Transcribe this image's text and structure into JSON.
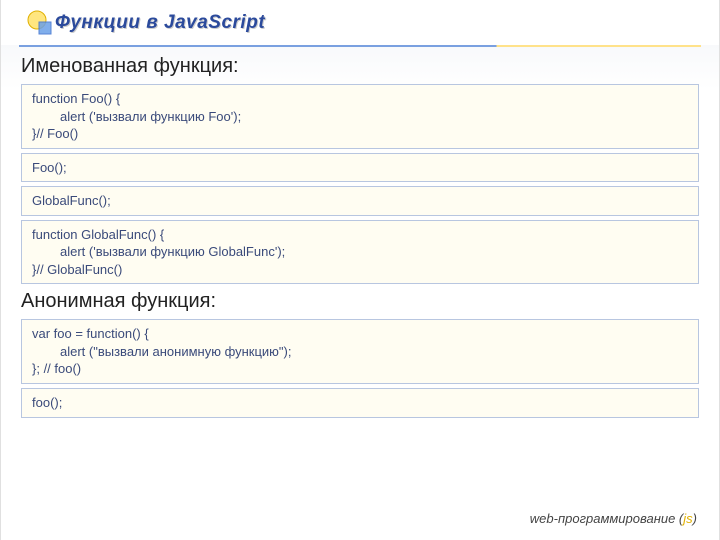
{
  "title": "Функции в JavaScript",
  "section1": "Именованная функция:",
  "box1": {
    "l1": "function Foo() {",
    "l2": "alert ('вызвали функцию Foo');",
    "l3": "}// Foo()"
  },
  "box2": {
    "l1": "Foo();"
  },
  "box3": {
    "l1": "GlobalFunc();"
  },
  "box4": {
    "l1": "function GlobalFunc() {",
    "l2": "alert ('вызвали функцию GlobalFunc');",
    "l3": "}// GlobalFunc()"
  },
  "section2": "Анонимная функция:",
  "box5": {
    "l1": "var foo = function() {",
    "l2": "alert (\"вызвали анонимную функцию\");",
    "l3": "}; // foo()"
  },
  "box6": {
    "l1": "foo();"
  },
  "footer": {
    "text": "web-программирование (",
    "js": "js",
    "close": ")"
  }
}
